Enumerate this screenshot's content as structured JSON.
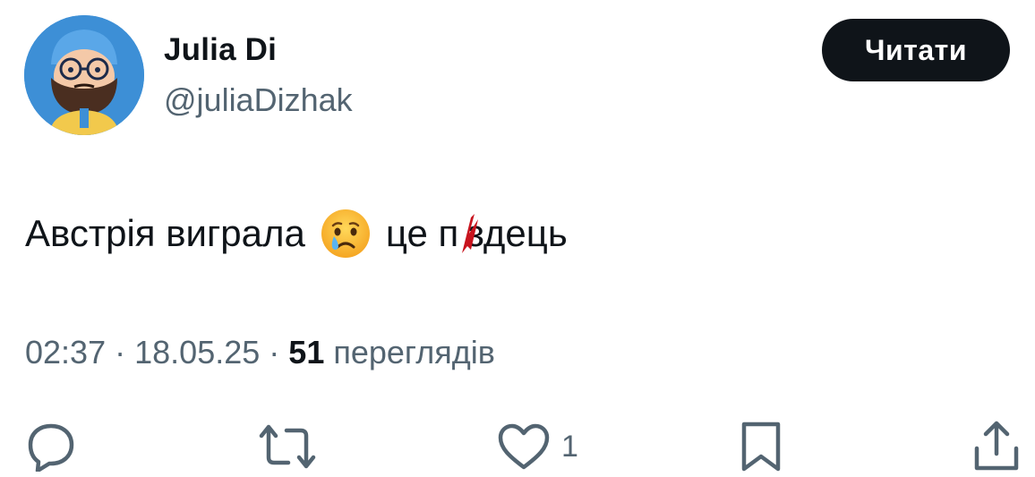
{
  "author": {
    "display_name": "Julia Di",
    "handle": "@juliaDizhak"
  },
  "follow_button": {
    "label": "Читати"
  },
  "tweet": {
    "text_before_emoji": "Австрія виграла",
    "emoji": "crying-face-emoji",
    "text_after_emoji_1": "це п",
    "censored_letter": "і",
    "text_after_emoji_2": "здець"
  },
  "meta": {
    "time": "02:37",
    "separator": "·",
    "date": "18.05.25",
    "views_count": "51",
    "views_label": "переглядів"
  },
  "actions": {
    "reply": {
      "icon": "reply-icon",
      "count": ""
    },
    "repost": {
      "icon": "repost-icon",
      "count": ""
    },
    "like": {
      "icon": "heart-icon",
      "count": "1"
    },
    "bookmark": {
      "icon": "bookmark-icon",
      "count": ""
    },
    "share": {
      "icon": "share-icon",
      "count": ""
    }
  },
  "colors": {
    "text_primary": "#0f1419",
    "text_secondary": "#536471",
    "button_bg": "#0f1419",
    "button_text": "#ffffff",
    "censor_mark": "#c8141e"
  }
}
